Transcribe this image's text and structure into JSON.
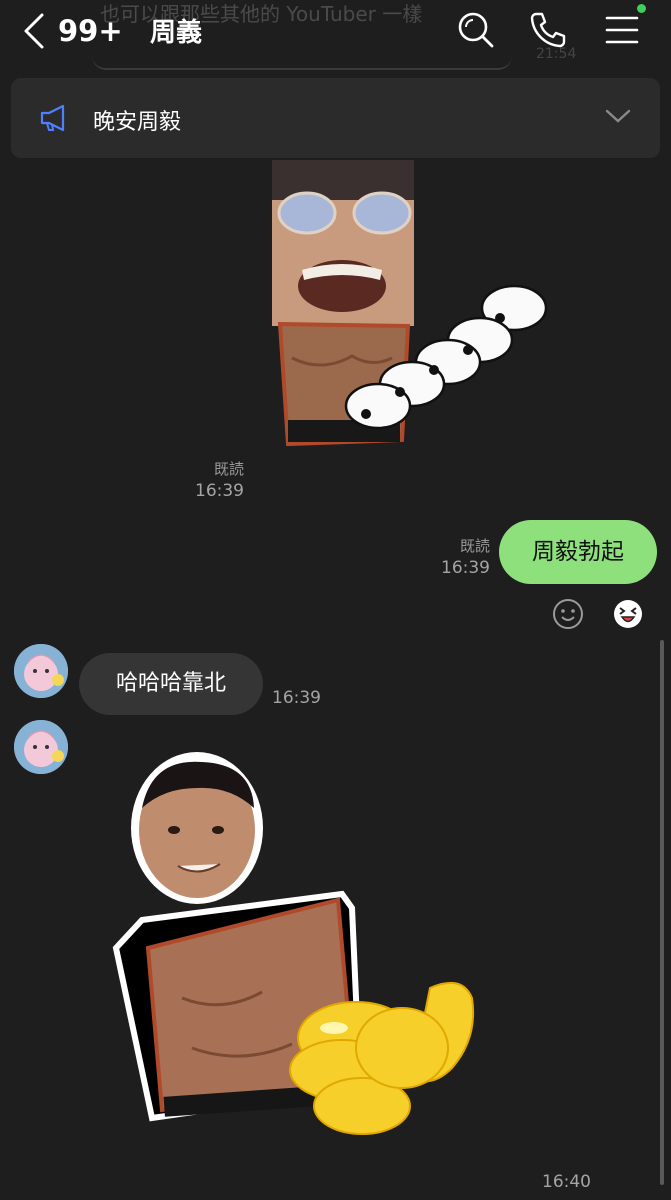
{
  "header": {
    "ghost_preview_text": "也可以跟那些其他的 YouTuber 一樣",
    "ghost_preview_time": "21:54",
    "unread_count": "99+",
    "chat_name": "周義",
    "icons": [
      "chevron-left-icon",
      "search-icon",
      "phone-icon",
      "menu-icon"
    ],
    "status_dot_color": "#3ecf5a"
  },
  "announcement": {
    "icon": "megaphone-icon",
    "text": "晚安周毅",
    "expand_icon": "chevron-down-icon"
  },
  "messages": [
    {
      "type": "sticker",
      "direction": "outgoing",
      "description_icon": "sticker",
      "read_label": "既読",
      "time": "16:39"
    },
    {
      "type": "text",
      "direction": "outgoing",
      "text": "周毅勃起",
      "read_label": "既読",
      "time": "16:39",
      "bubble_color": "#8de07c"
    },
    {
      "type": "reactions",
      "icons": [
        "smiley-icon",
        "laughing-face-icon"
      ]
    },
    {
      "type": "text",
      "direction": "incoming",
      "text": "哈哈哈靠北",
      "time": "16:39"
    },
    {
      "type": "sticker",
      "direction": "incoming",
      "time": "16:40"
    }
  ]
}
